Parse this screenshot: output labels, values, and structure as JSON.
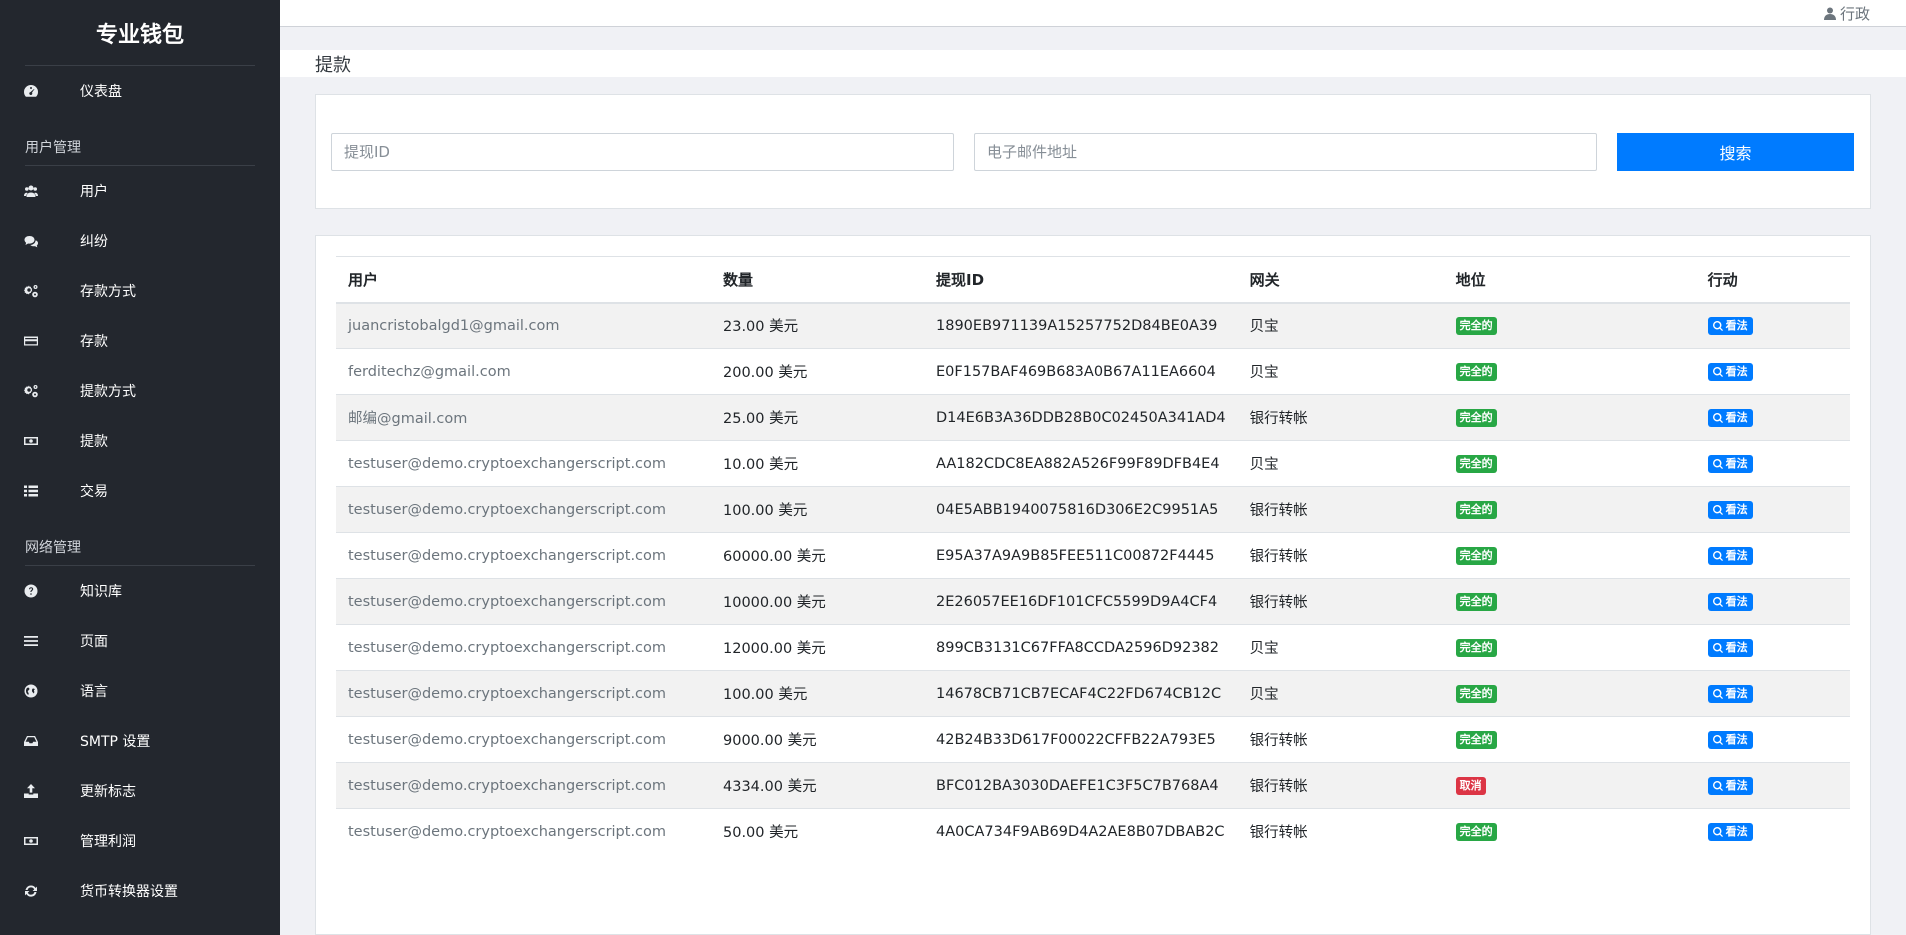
{
  "app": {
    "brand": "专业钱包"
  },
  "sidebar": {
    "top_items": [
      {
        "label": "仪表盘",
        "icon": "dashboard-icon"
      }
    ],
    "sections": [
      {
        "title": "用户管理",
        "items": [
          {
            "label": "用户",
            "icon": "users-icon"
          },
          {
            "label": "纠纷",
            "icon": "comments-icon"
          },
          {
            "label": "存款方式",
            "icon": "cogs-icon"
          },
          {
            "label": "存款",
            "icon": "credit-card-icon"
          },
          {
            "label": "提款方式",
            "icon": "cogs-icon"
          },
          {
            "label": "提款",
            "icon": "money-icon"
          },
          {
            "label": "交易",
            "icon": "list-icon"
          }
        ]
      },
      {
        "title": "网络管理",
        "items": [
          {
            "label": "知识库",
            "icon": "question-icon"
          },
          {
            "label": "页面",
            "icon": "bars-icon"
          },
          {
            "label": "语言",
            "icon": "globe-icon"
          },
          {
            "label": "SMTP 设置",
            "icon": "inbox-icon"
          },
          {
            "label": "更新标志",
            "icon": "upload-icon"
          },
          {
            "label": "管理利润",
            "icon": "money-icon"
          },
          {
            "label": "货币转换器设置",
            "icon": "refresh-icon"
          }
        ]
      }
    ]
  },
  "topbar": {
    "user_label": "行政"
  },
  "page": {
    "title": "提款"
  },
  "search": {
    "withdraw_id_placeholder": "提现ID",
    "email_placeholder": "电子邮件地址",
    "button_label": "搜索"
  },
  "table": {
    "headers": [
      "用户",
      "数量",
      "提现ID",
      "网关",
      "地位",
      "行动"
    ],
    "view_label": "看法",
    "rows": [
      {
        "user": "juancristobalgd1@gmail.com",
        "amount": "23.00 美元",
        "id": "1890EB971139A15257752D84BE0A39",
        "gateway": "贝宝",
        "status": "完全的",
        "status_type": "success"
      },
      {
        "user": "ferditechz@gmail.com",
        "amount": "200.00 美元",
        "id": "E0F157BAF469B683A0B67A11EA6604",
        "gateway": "贝宝",
        "status": "完全的",
        "status_type": "success"
      },
      {
        "user": "邮编@gmail.com",
        "amount": "25.00 美元",
        "id": "D14E6B3A36DDB28B0C02450A341AD4",
        "gateway": "银行转帐",
        "status": "完全的",
        "status_type": "success"
      },
      {
        "user": "testuser@demo.cryptoexchangerscript.com",
        "amount": "10.00 美元",
        "id": "AA182CDC8EA882A526F99F89DFB4E4",
        "gateway": "贝宝",
        "status": "完全的",
        "status_type": "success"
      },
      {
        "user": "testuser@demo.cryptoexchangerscript.com",
        "amount": "100.00 美元",
        "id": "04E5ABB1940075816D306E2C9951A5",
        "gateway": "银行转帐",
        "status": "完全的",
        "status_type": "success"
      },
      {
        "user": "testuser@demo.cryptoexchangerscript.com",
        "amount": "60000.00 美元",
        "id": "E95A37A9A9B85FEE511C00872F4445",
        "gateway": "银行转帐",
        "status": "完全的",
        "status_type": "success"
      },
      {
        "user": "testuser@demo.cryptoexchangerscript.com",
        "amount": "10000.00 美元",
        "id": "2E26057EE16DF101CFC5599D9A4CF4",
        "gateway": "银行转帐",
        "status": "完全的",
        "status_type": "success"
      },
      {
        "user": "testuser@demo.cryptoexchangerscript.com",
        "amount": "12000.00 美元",
        "id": "899CB3131C67FFA8CCDA2596D92382",
        "gateway": "贝宝",
        "status": "完全的",
        "status_type": "success"
      },
      {
        "user": "testuser@demo.cryptoexchangerscript.com",
        "amount": "100.00 美元",
        "id": "14678CB71CB7ECAF4C22FD674CB12C",
        "gateway": "贝宝",
        "status": "完全的",
        "status_type": "success"
      },
      {
        "user": "testuser@demo.cryptoexchangerscript.com",
        "amount": "9000.00 美元",
        "id": "42B24B33D617F00022CFFB22A793E5",
        "gateway": "银行转帐",
        "status": "完全的",
        "status_type": "success"
      },
      {
        "user": "testuser@demo.cryptoexchangerscript.com",
        "amount": "4334.00 美元",
        "id": "BFC012BA3030DAEFE1C3F5C7B768A4",
        "gateway": "银行转帐",
        "status": "取消",
        "status_type": "danger"
      },
      {
        "user": "testuser@demo.cryptoexchangerscript.com",
        "amount": "50.00 美元",
        "id": "4A0CA734F9AB69D4A2AE8B07DBAB2C",
        "gateway": "银行转帐",
        "status": "完全的",
        "status_type": "success"
      }
    ]
  },
  "colors": {
    "sidebar_bg": "#23272e",
    "primary": "#007bff",
    "success": "#28a745",
    "danger": "#dc3545"
  }
}
